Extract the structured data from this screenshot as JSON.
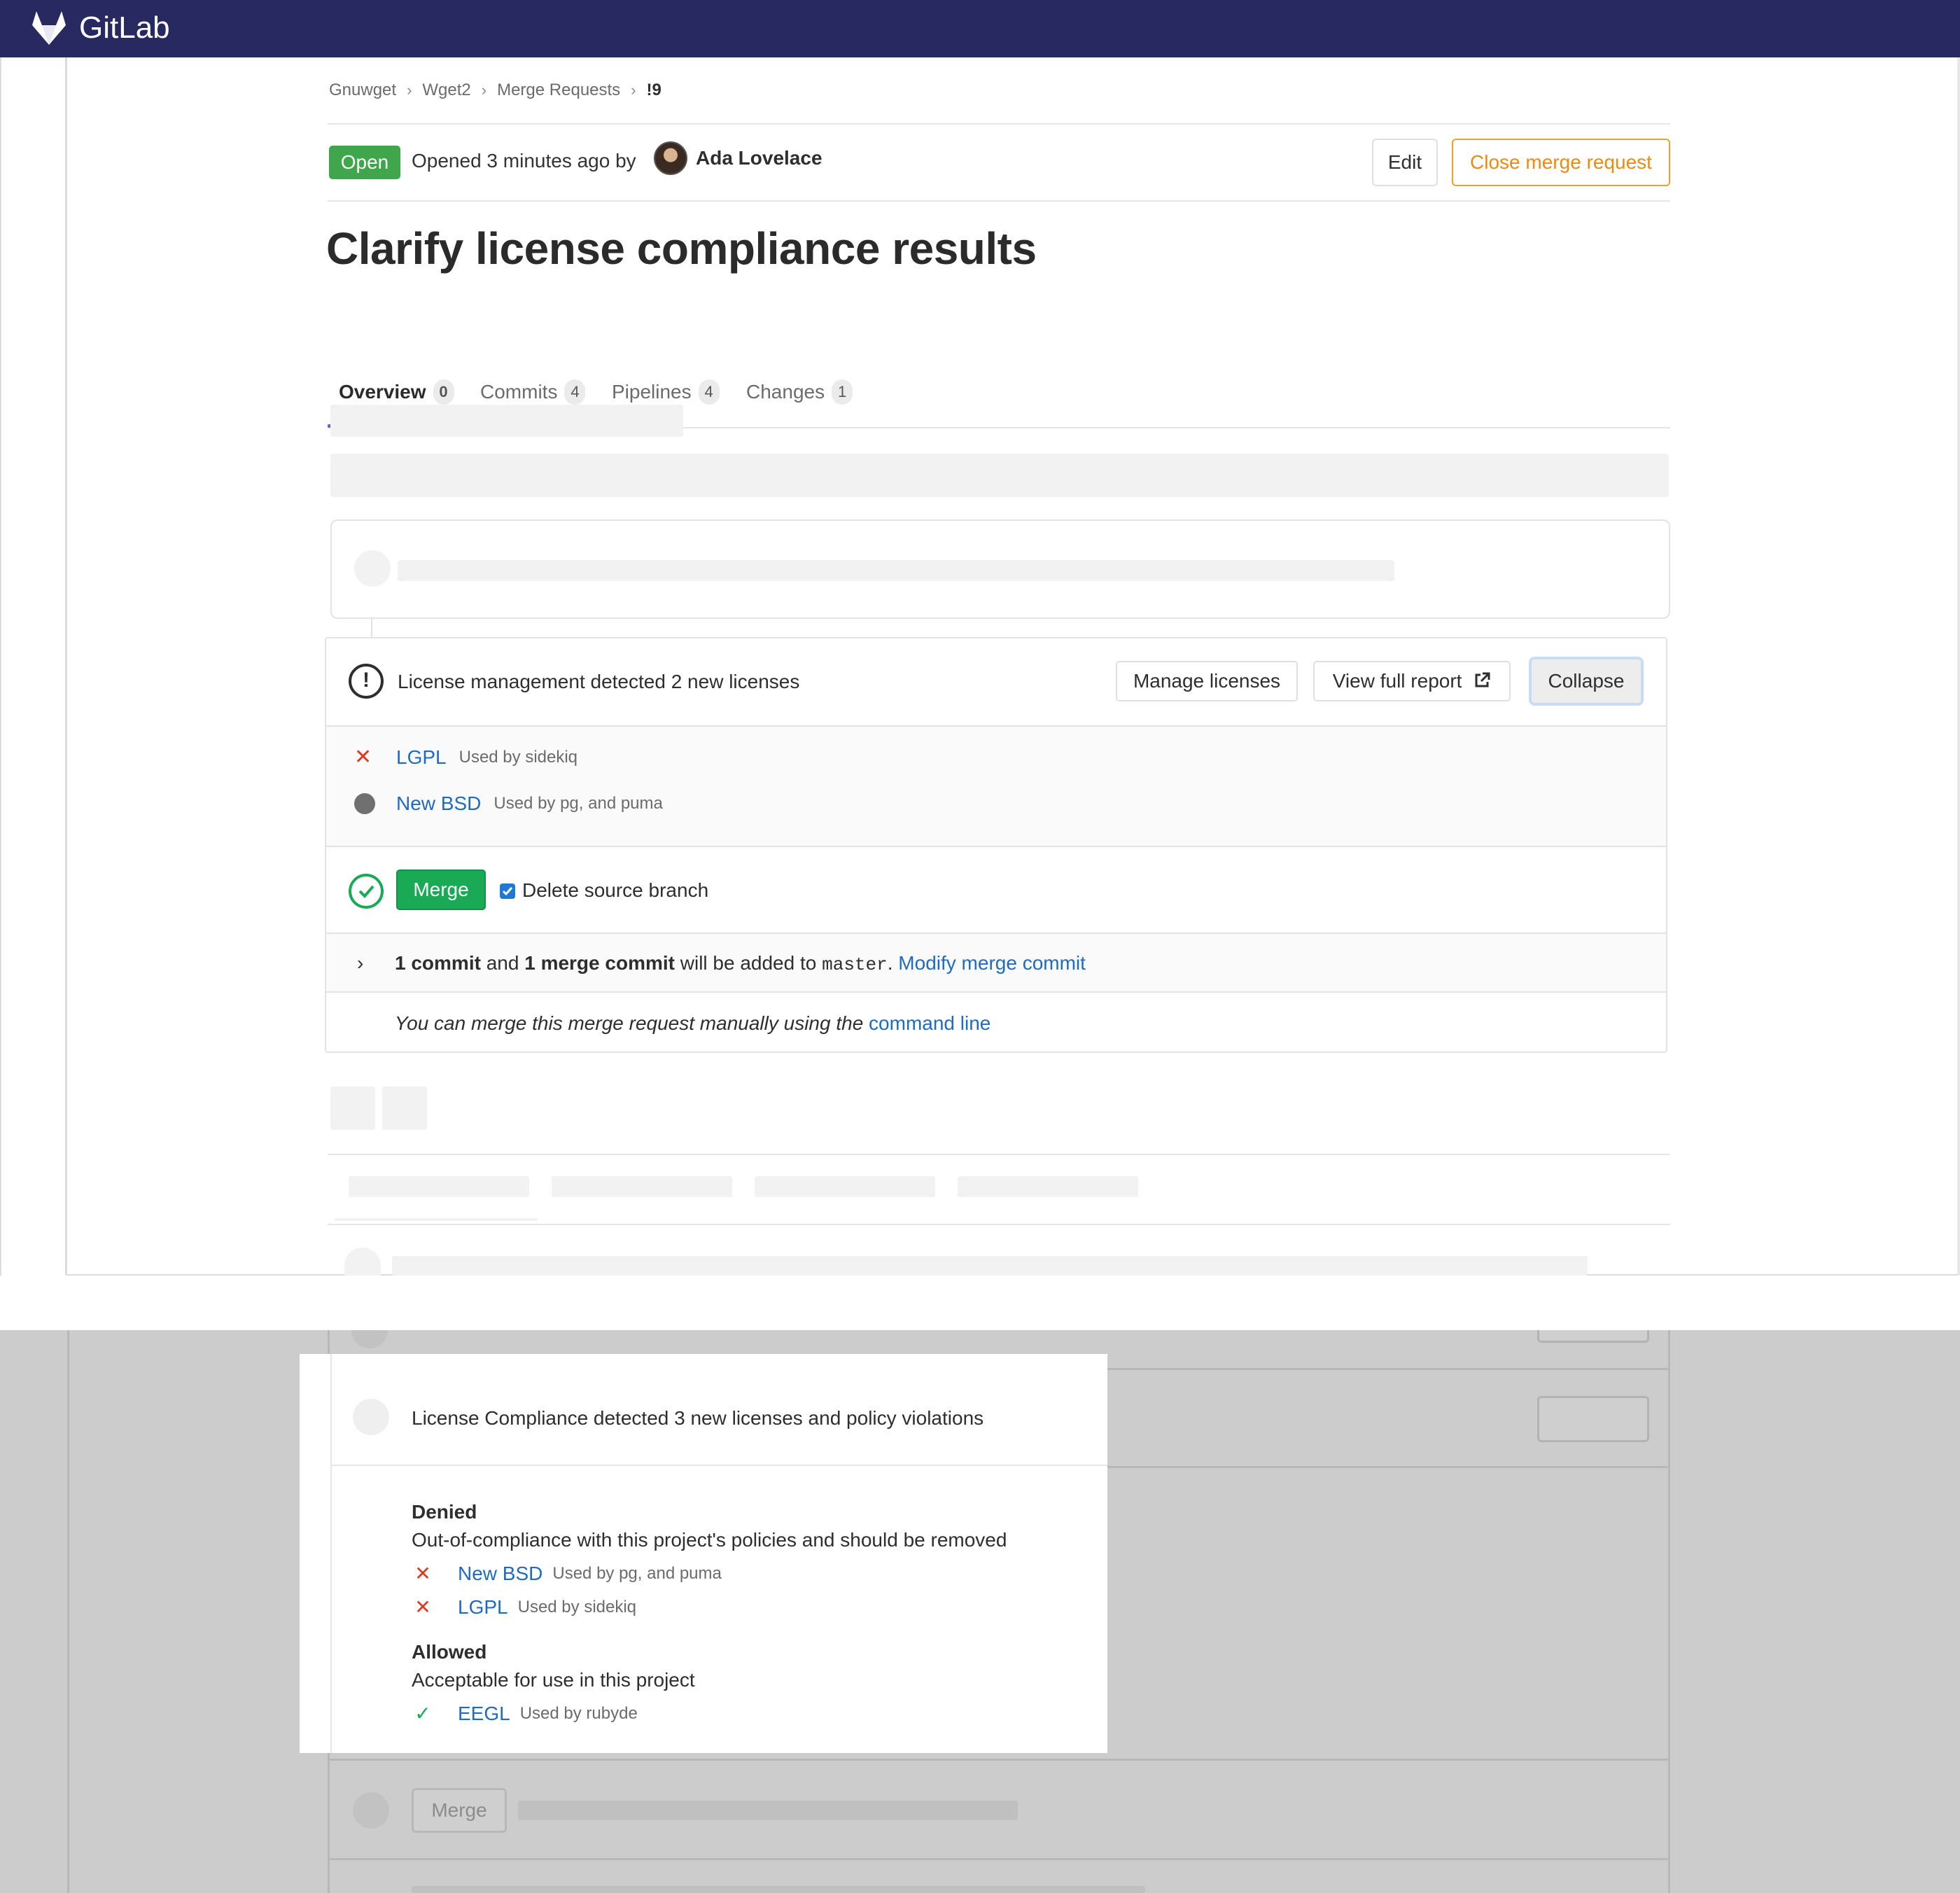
{
  "navbar": {
    "brand": "GitLab"
  },
  "breadcrumb": {
    "items": [
      "Gnuwget",
      "Wget2",
      "Merge Requests"
    ],
    "current": "!9",
    "separator": "›"
  },
  "header": {
    "status_badge": "Open",
    "opened_text": "Opened 3 minutes ago by",
    "author": "Ada Lovelace",
    "edit_label": "Edit",
    "close_label": "Close merge request"
  },
  "title": "Clarify license compliance results",
  "tabs": [
    {
      "label": "Overview",
      "count": "0"
    },
    {
      "label": "Commits",
      "count": "4"
    },
    {
      "label": "Pipelines",
      "count": "4"
    },
    {
      "label": "Changes",
      "count": "1"
    }
  ],
  "license_widget": {
    "summary": "License management detected 2 new licenses",
    "manage_label": "Manage licenses",
    "report_label": "View full report",
    "collapse_label": "Collapse",
    "licenses": [
      {
        "name": "LGPL",
        "used_by": "Used by sidekiq",
        "status_icon": "close-x-icon"
      },
      {
        "name": "New BSD",
        "used_by": "Used by pg, and puma",
        "status_icon": "neutral-dot-icon"
      }
    ]
  },
  "merge": {
    "merge_label": "Merge",
    "delete_branch_label": "Delete source branch",
    "delete_branch_checked": true,
    "commit_count": "1 commit",
    "and": "and",
    "merge_commit": "1 merge commit",
    "will_be_added": "will be added to",
    "target_branch": "master",
    "period": ".",
    "modify_link": "Modify merge commit",
    "cli_text": "You can merge this merge request manually using the",
    "cli_link": "command line"
  },
  "compliance_zoom": {
    "summary": "License Compliance detected 3 new licenses and policy violations",
    "denied": {
      "title": "Denied",
      "description": "Out-of-compliance with this project's policies and should be removed",
      "licenses": [
        {
          "name": "New BSD",
          "used_by": "Used by pg, and puma"
        },
        {
          "name": "LGPL",
          "used_by": "Used by sidekiq"
        }
      ]
    },
    "allowed": {
      "title": "Allowed",
      "description": "Acceptable for use in this project",
      "licenses": [
        {
          "name": "EEGL",
          "used_by": "Used by rubyde"
        }
      ]
    }
  },
  "lower_ghost": {
    "merge_label": "Merge"
  },
  "colors": {
    "navbar": "#292961",
    "open_badge": "#3fa64c",
    "close_button": "#ea8a17",
    "merge_button": "#1aaa55",
    "link": "#1f6bc4",
    "denied": "#db3b21",
    "allowed": "#1aaa55",
    "tab_underline": "#6b5fc6"
  }
}
